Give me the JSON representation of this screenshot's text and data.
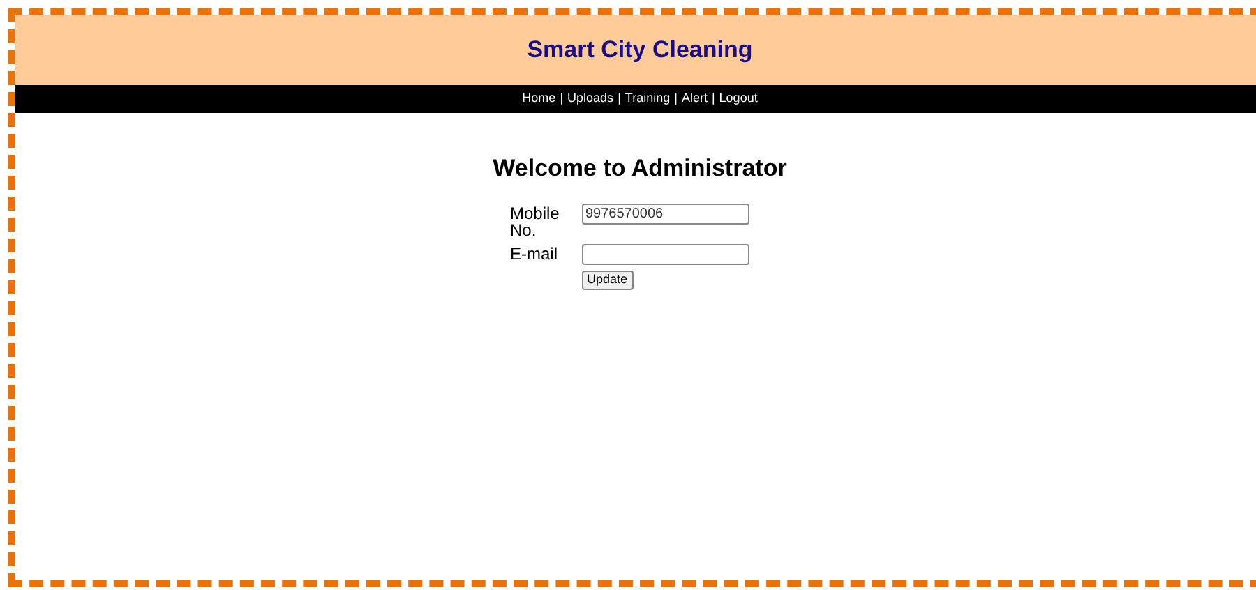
{
  "header": {
    "title": "Smart City Cleaning"
  },
  "nav": {
    "separator": "|",
    "links": [
      {
        "label": "Home"
      },
      {
        "label": "Uploads"
      },
      {
        "label": "Training"
      },
      {
        "label": "Alert"
      },
      {
        "label": "Logout"
      }
    ]
  },
  "heading": "Welcome to Administrator",
  "form": {
    "fields": [
      {
        "label": "Mobile No.",
        "value": "9976570006"
      },
      {
        "label": "E-mail"
      }
    ],
    "submit": "Update"
  }
}
